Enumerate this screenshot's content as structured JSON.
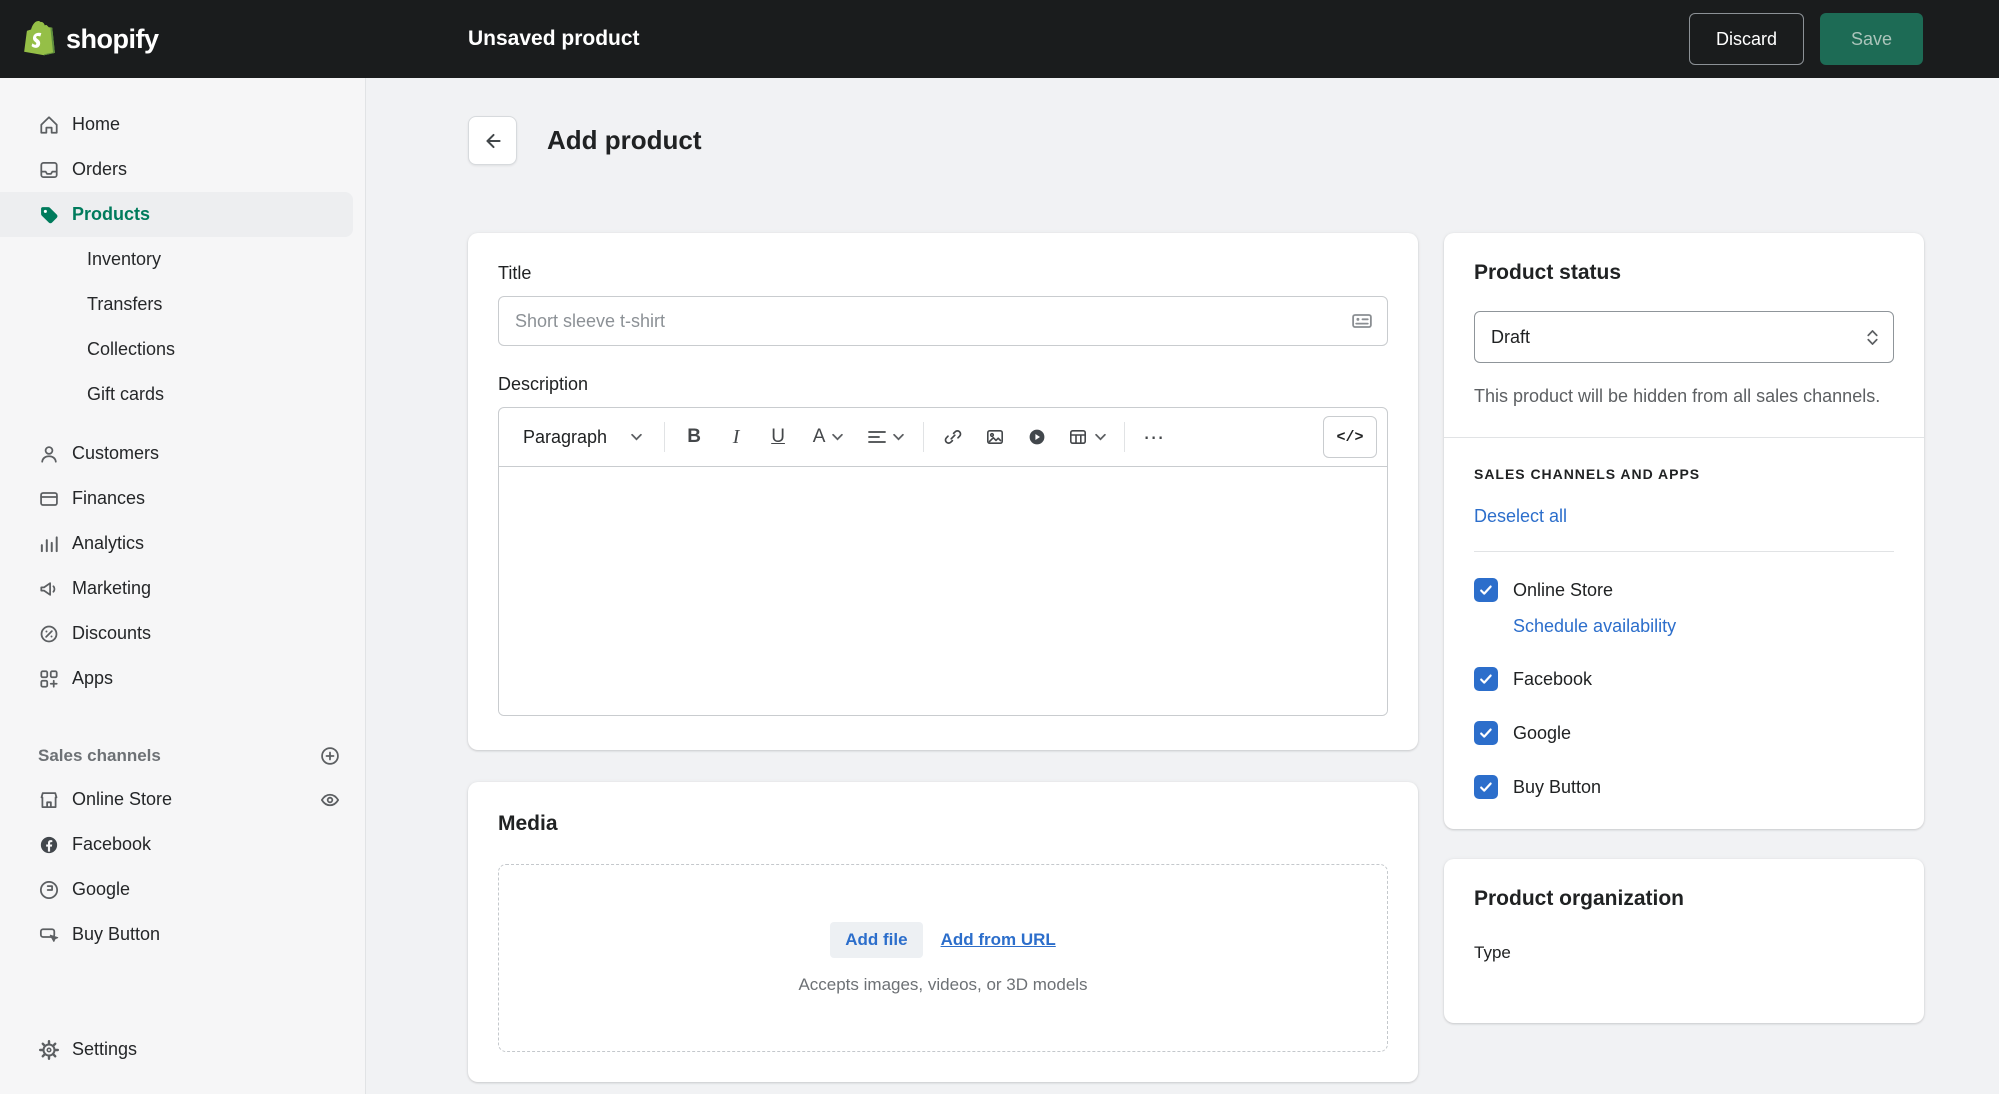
{
  "topbar": {
    "brand": "shopify",
    "title": "Unsaved product",
    "discard_label": "Discard",
    "save_label": "Save"
  },
  "sidebar": {
    "nav": [
      {
        "label": "Home"
      },
      {
        "label": "Orders"
      },
      {
        "label": "Products",
        "active": true
      }
    ],
    "products_sub": [
      {
        "label": "Inventory"
      },
      {
        "label": "Transfers"
      },
      {
        "label": "Collections"
      },
      {
        "label": "Gift cards"
      }
    ],
    "nav2": [
      {
        "label": "Customers"
      },
      {
        "label": "Finances"
      },
      {
        "label": "Analytics"
      },
      {
        "label": "Marketing"
      },
      {
        "label": "Discounts"
      },
      {
        "label": "Apps"
      }
    ],
    "sales_channels_header": "Sales channels",
    "channels": [
      {
        "label": "Online Store"
      },
      {
        "label": "Facebook"
      },
      {
        "label": "Google"
      },
      {
        "label": "Buy Button"
      }
    ],
    "settings_label": "Settings"
  },
  "page": {
    "title": "Add product"
  },
  "details_card": {
    "title_label": "Title",
    "title_placeholder": "Short sleeve t-shirt",
    "description_label": "Description",
    "editor_toolbar": {
      "paragraph_label": "Paragraph",
      "bold_label": "B",
      "italic_label": "I",
      "underline_label": "U",
      "text_color_label": "A",
      "more_label": "⋯",
      "code_label": "</>"
    }
  },
  "media_card": {
    "heading": "Media",
    "add_file_label": "Add file",
    "add_from_url_label": "Add from URL",
    "hint": "Accepts images, videos, or 3D models"
  },
  "status_card": {
    "heading": "Product status",
    "status_value": "Draft",
    "help_text": "This product will be hidden from all sales channels.",
    "section_header": "SALES CHANNELS AND APPS",
    "deselect_all_label": "Deselect all",
    "channels": [
      {
        "label": "Online Store",
        "checked": true,
        "sublink": "Schedule availability"
      },
      {
        "label": "Facebook",
        "checked": true
      },
      {
        "label": "Google",
        "checked": true
      },
      {
        "label": "Buy Button",
        "checked": true
      }
    ]
  },
  "organization_card": {
    "heading": "Product organization",
    "type_label": "Type"
  },
  "colors": {
    "accent_green": "#007b5c",
    "link_blue": "#2c6ecb",
    "checkbox_blue": "#2c6ecb",
    "topbar_bg": "#1a1c1d",
    "save_green": "#1d6b55"
  }
}
